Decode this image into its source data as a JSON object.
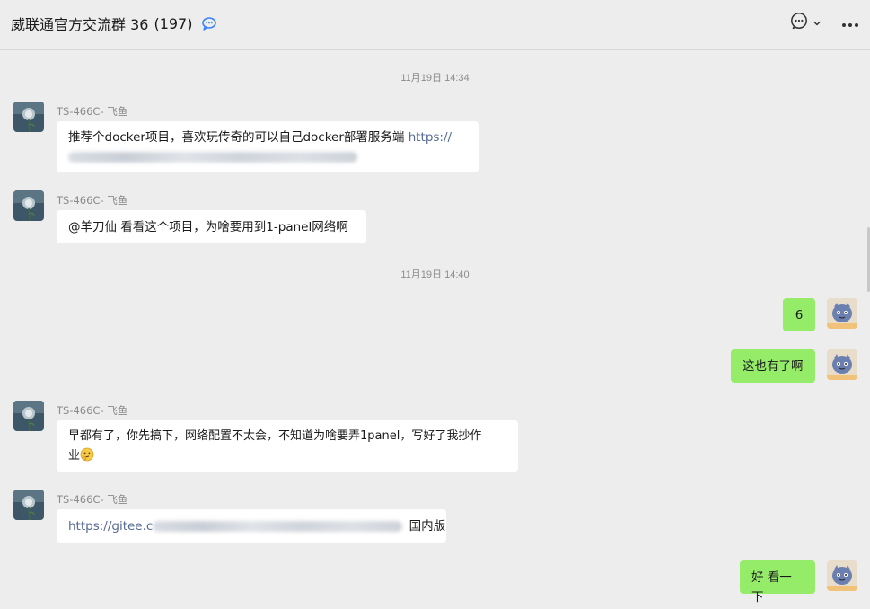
{
  "header": {
    "title": "威联通官方交流群 36",
    "member_count": "(197)",
    "icons": [
      "chat-bubble-blue-icon",
      "comment-icon",
      "chevron-down-icon",
      "more-icon"
    ]
  },
  "colors": {
    "outgoing_bubble": "#95ec69",
    "incoming_bubble": "#ffffff",
    "link": "#576b95",
    "background": "#ededed"
  },
  "messages": {
    "t1": "11月19日 14:34",
    "m1": {
      "sender": "TS-466C- 飞鱼",
      "text": "推荐个docker项目，喜欢玩传奇的可以自己docker部署服务端 ",
      "link": "https://"
    },
    "m2": {
      "sender": "TS-466C- 飞鱼",
      "text": "@羊刀仙 看看这个项目，为啥要用到1-panel网络啊"
    },
    "t2": "11月19日 14:40",
    "m3": {
      "text": "6"
    },
    "m4": {
      "text": "这也有了啊"
    },
    "m5": {
      "sender": "TS-466C- 飞鱼",
      "line1": "早都有了，你先搞下，网络配置不太会，不知道为啥要弄1panel，写好了我抄作",
      "line2": "业"
    },
    "m6": {
      "sender": "TS-466C- 飞鱼",
      "link": "https://gitee.c",
      "suffix": "国内版"
    },
    "m7": {
      "text": "好 看一下"
    }
  }
}
